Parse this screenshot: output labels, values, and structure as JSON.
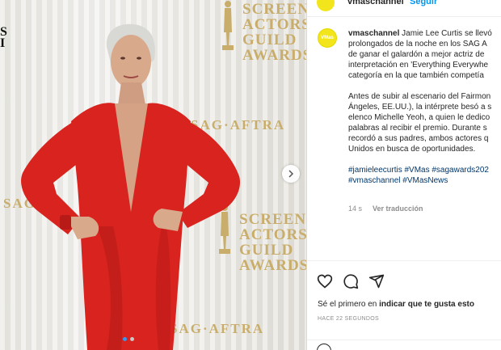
{
  "post_header": {
    "username": "vmaschannel",
    "follow_label": "Seguir"
  },
  "avatar": {
    "text": "VMas",
    "color": "#f2e51b"
  },
  "media": {
    "edge_text": "S\nI",
    "backdrop_logo": "SCREEN\nACTORS\nGUILD\nAWARDS",
    "backdrop_banner": "SAG·AFTRA",
    "backdrop_banner_left": "SAG·",
    "dots_total": 2,
    "dots_active": 1
  },
  "caption": {
    "username": "vmaschannel",
    "lines": [
      " Jamie Lee Curtis se llevó",
      "prolongados de la noche en los SAG A",
      "de ganar el galardón a mejor actriz de",
      "interpretación en 'Everything Everywhe",
      "categoría en la que también competía"
    ],
    "para2": [
      "Antes de subir al escenario del Fairmon",
      "Ángeles, EE.UU.), la intérprete besó a s",
      "elenco Michelle Yeoh, a quien le dedico",
      "palabras al recibir el premio. Durante s",
      "recordó a sus padres, ambos actores q",
      "Unidos en busca de oportunidades."
    ],
    "tags": [
      "#jamieleecurtis #VMas #sagawards202",
      "#vmaschannel #VMasNews"
    ]
  },
  "meta": {
    "age": "14 s",
    "translate_label": "Ver traducción"
  },
  "actions": {
    "likes_prefix": "Sé el primero en ",
    "likes_link": "indicar que te gusta esto",
    "timestamp": "HACE 22 SEGUNDOS"
  },
  "colors": {
    "accent": "#0095f6",
    "dress_red": "#d8231f",
    "gold": "#c9ad6a"
  }
}
